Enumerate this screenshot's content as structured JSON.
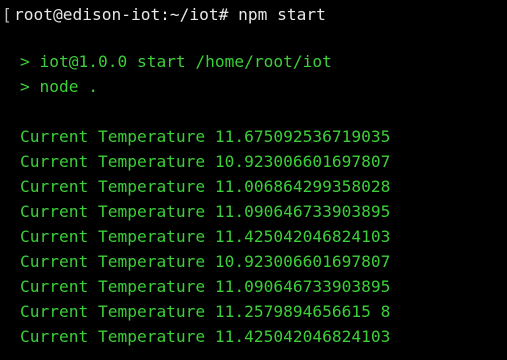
{
  "terminal": {
    "prompt": "root@edison-iot:~/iot# npm start",
    "open_bracket": "[",
    "npm_output": [
      "> iot@1.0.0 start /home/root/iot",
      "> node ."
    ],
    "readings": [
      "Current Temperature 11.675092536719035",
      "Current Temperature 10.923006601697807",
      "Current Temperature 11.006864299358028",
      "Current Temperature 11.090646733903895",
      "Current Temperature 11.425042046824103",
      "Current Temperature 10.923006601697807",
      "Current Temperature 11.090646733903895",
      "Current Temperature 11.2579894656615 8",
      "Current Temperature 11.425042046824103"
    ],
    "colors": {
      "background": "#000000",
      "prompt_text": "#e8e8e8",
      "output_text": "#3ccf39"
    }
  }
}
